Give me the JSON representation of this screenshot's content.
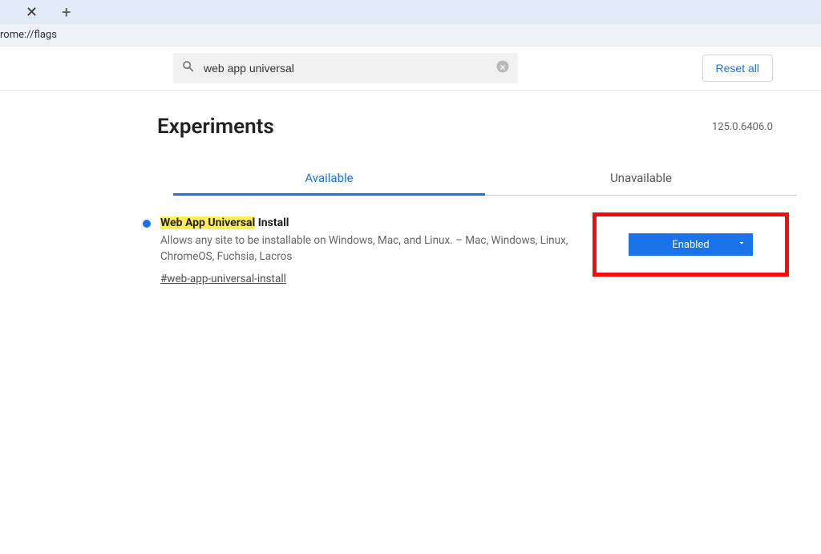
{
  "browser": {
    "url": "rome://flags"
  },
  "toolbar": {
    "search_value": "web app universal",
    "reset_label": "Reset all"
  },
  "page": {
    "heading": "Experiments",
    "version": "125.0.6406.0"
  },
  "tabs": {
    "available": "Available",
    "unavailable": "Unavailable"
  },
  "flag": {
    "title_highlight": "Web App Universal",
    "title_rest": " Install",
    "description": "Allows any site to be installable on Windows, Mac, and Linux. – Mac, Windows, Linux, ChromeOS, Fuchsia, Lacros",
    "anchor": "#web-app-universal-install",
    "dropdown_value": "Enabled"
  }
}
